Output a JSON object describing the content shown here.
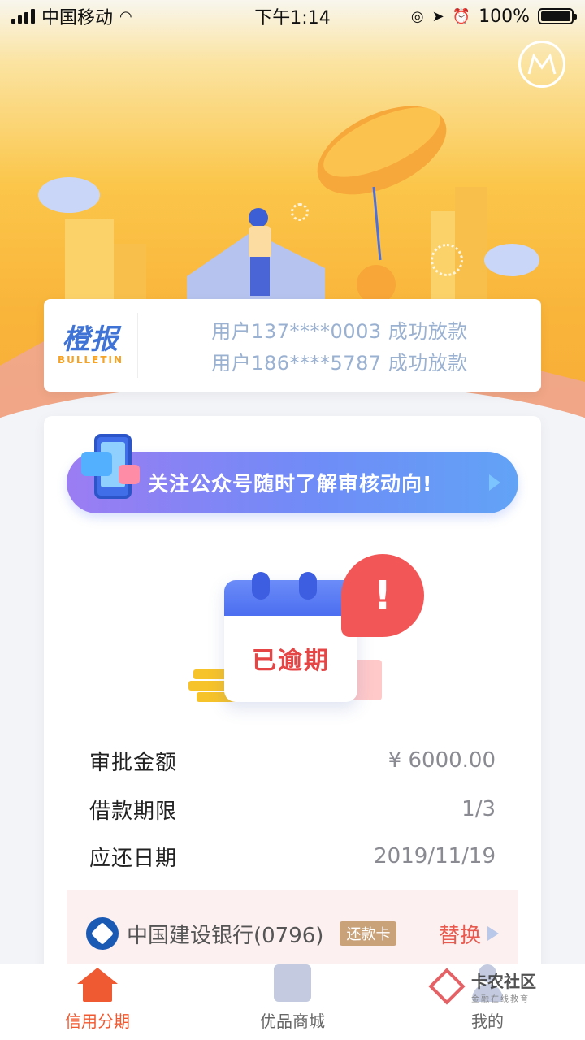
{
  "status_bar": {
    "carrier": "中国移动",
    "time": "下午1:14",
    "battery": "100%"
  },
  "bulletin": {
    "title": "橙报",
    "subtitle": "BULLETIN",
    "messages": [
      "用户137****0003 成功放款",
      "用户186****5787 成功放款"
    ]
  },
  "banner": {
    "text": "关注公众号随时了解审核动向!"
  },
  "status": {
    "label": "已逾期",
    "alert_symbol": "!"
  },
  "details": [
    {
      "label": "审批金额",
      "value": "¥ 6000.00"
    },
    {
      "label": "借款期限",
      "value": "1/3"
    },
    {
      "label": "应还日期",
      "value": "2019/11/19"
    }
  ],
  "bank": {
    "name": "中国建设银行(0796)",
    "tag": "还款卡",
    "action": "替换"
  },
  "tabs": [
    {
      "label": "信用分期",
      "icon": "home-icon",
      "active": true
    },
    {
      "label": "优品商城",
      "icon": "shopping-bag-icon",
      "active": false
    },
    {
      "label": "我的",
      "icon": "person-icon",
      "active": false
    }
  ],
  "watermark": {
    "title": "卡农社区",
    "subtitle": "金融在线教育"
  },
  "colors": {
    "accent": "#f0582f",
    "banner_start": "#9b7cf3",
    "banner_end": "#62a3f6",
    "overdue": "#e64545",
    "hero": "#f9b43a"
  }
}
